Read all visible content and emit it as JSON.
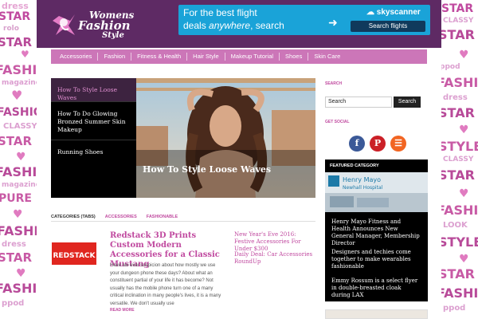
{
  "site": {
    "logo_line1": "Womens",
    "logo_line2": "Fashion",
    "logo_line3": "Style"
  },
  "ad": {
    "line1": "For the best flight",
    "line2_a": "deals ",
    "line2_em": "anywhere",
    "line2_b": ", search",
    "brand": "skyscanner",
    "button": "Search flights"
  },
  "nav": [
    "Accessories",
    "Fashion",
    "Fitness & Health",
    "Hair Style",
    "Makeup Tutorial",
    "Shoes",
    "Skin Care"
  ],
  "featured": {
    "items": [
      "How To Style Loose Waves",
      "How To Do Glowing Bronzed Summer Skin Makeup",
      "Running Shoes"
    ],
    "caption": "How To Style Loose Waves"
  },
  "categories": {
    "label": "CATEGORIES (TABS)",
    "tabs": [
      "ACCESSORIES",
      "FASHIONABLE"
    ]
  },
  "post": {
    "title": "Redstack 3D Prints Custom Modern Accessories for a Classic Mustang",
    "body": "Have we ever suspicion about how mostly we use your dungeon phone these days? About what an constituent partial of your life it has become? Not usually has the mobile phone turn one of a many critical inclination in many people's lives, it is a many versatile. We don't usually use",
    "read_more": "READ MORE",
    "thumb_label": "REDSTACK"
  },
  "side_posts": [
    "New Year's Eve 2016: Festive Accessories For Under $300",
    "Daily Deal: Car Accessories RoundUp"
  ],
  "sidebar": {
    "search_title": "SEARCH",
    "search_value": "Search",
    "search_button": "Search",
    "social_title": "GET SOCIAL",
    "social_icons": [
      "facebook-icon",
      "pinterest-icon",
      "rss-icon"
    ],
    "featured_title": "FEATURED CATEGORY",
    "hospital_name_1": "Henry Mayo",
    "hospital_name_2": "Newhall Hospital",
    "featured_items": [
      "Henry Mayo Fitness and Health Announces New General Manager, Membership Director",
      "Designers and techies come together to make wearables fashionable",
      "Emmy Rossum is a select flyer in double-breasted cloak during LAX"
    ]
  },
  "colors": {
    "header": "#5e2a64",
    "nav": "#cc76b8",
    "accent": "#c0499f",
    "ad": "#1aa3d8"
  },
  "wallpaper": {
    "words": [
      "FASHION",
      "dress",
      "STAR",
      "PURE",
      "style",
      "magazine",
      "CLASSY",
      "LOOK",
      "STYLE",
      "ppod",
      "rolo"
    ]
  }
}
